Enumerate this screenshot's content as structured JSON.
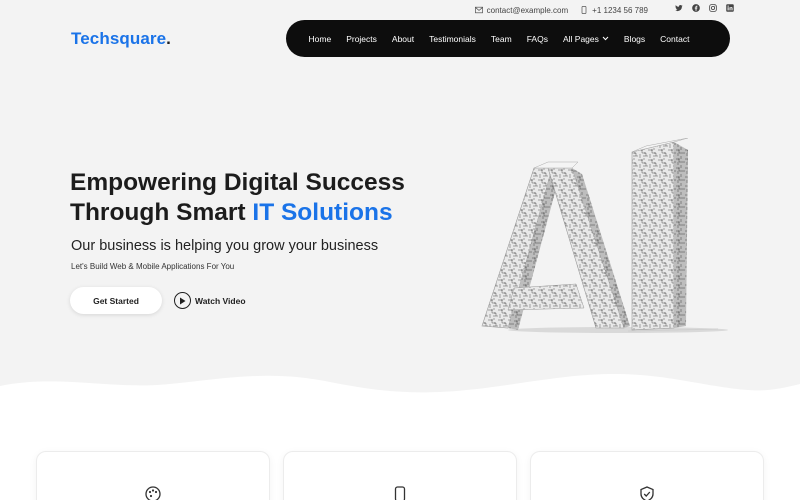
{
  "topbar": {
    "email": "contact@example.com",
    "phone": "+1 1234 56 789",
    "social": [
      "twitter-icon",
      "facebook-icon",
      "instagram-icon",
      "linkedin-icon"
    ]
  },
  "brand": {
    "name": "Techsquare",
    "dot": "."
  },
  "nav": {
    "home": "Home",
    "projects": "Projects",
    "about": "About",
    "testimonials": "Testimonials",
    "team": "Team",
    "faqs": "FAQs",
    "all_pages": "All Pages",
    "blogs": "Blogs",
    "contact": "Contact"
  },
  "hero": {
    "line1": "Empowering Digital Success",
    "line2_prefix": "Through Smart ",
    "line2_accent": "IT Solutions",
    "subhead": "Our business is helping you grow your business",
    "tagline": "Let's Build Web & Mobile Applications For You",
    "cta_label": "Get Started",
    "video_label": "Watch Video"
  },
  "features": {
    "cards": [
      {
        "icon": "palette-icon"
      },
      {
        "icon": "mobile-icon"
      },
      {
        "icon": "shield-check-icon"
      }
    ]
  },
  "colors": {
    "accent": "#1a73e8",
    "nav_bg": "#0d0d0d",
    "hero_bg": "#f3f3f3"
  }
}
